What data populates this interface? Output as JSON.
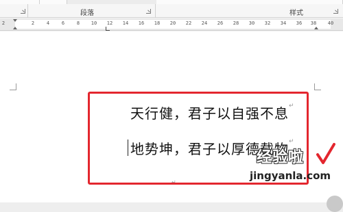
{
  "ribbon": {
    "paragraph_group_label": "段落",
    "styles_group_label": "样式"
  },
  "ruler": {
    "numbers": [
      "2",
      "2",
      "4",
      "6",
      "8",
      "10",
      "12",
      "14",
      "16",
      "18",
      "20",
      "22",
      "24",
      "26",
      "28",
      "30",
      "32",
      "34",
      "36",
      "38",
      "40"
    ]
  },
  "document": {
    "lines": [
      "天行健，君子以自强不息",
      "地势坤，君子以厚德载物"
    ],
    "paragraph_mark": "↵"
  },
  "watermark": {
    "title": "经验啦",
    "url": "jingyanla.com"
  },
  "colors": {
    "highlight_border": "#e3262e",
    "watermark_check": "#e3262e"
  }
}
